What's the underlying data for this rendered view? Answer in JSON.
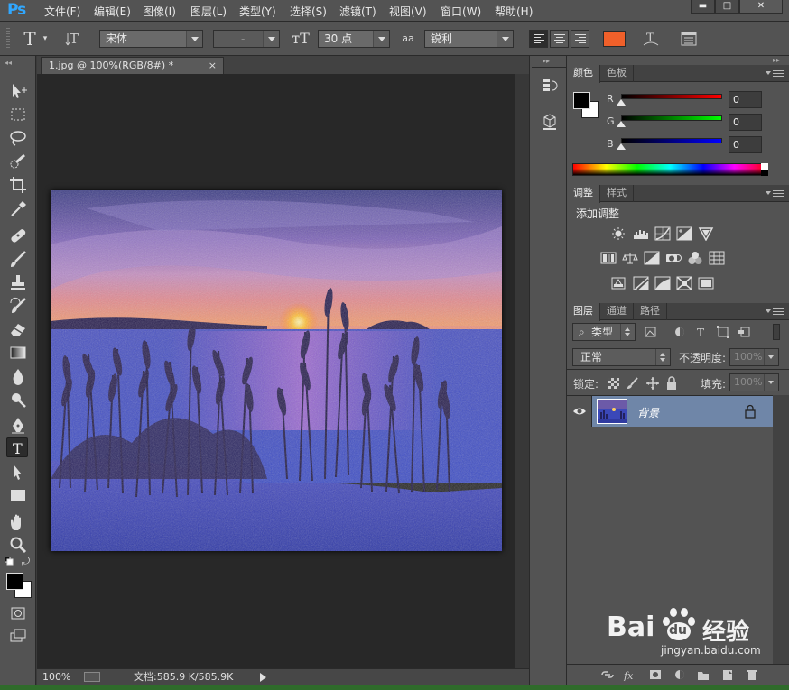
{
  "app": {
    "logo": "Ps"
  },
  "menu": [
    "文件(F)",
    "编辑(E)",
    "图像(I)",
    "图层(L)",
    "类型(Y)",
    "选择(S)",
    "滤镜(T)",
    "视图(V)",
    "窗口(W)",
    "帮助(H)"
  ],
  "window_controls": {
    "minimize": "▬",
    "maximize": "□",
    "close": "✕"
  },
  "options": {
    "font_family": "宋体",
    "font_style": "-",
    "font_size": "30 点",
    "antialias_label": "aa",
    "antialias": "锐利",
    "text_color": "#f0602a"
  },
  "document": {
    "tab_title": "1.jpg @ 100%(RGB/8#) *",
    "tab_close": "×",
    "zoom": "100%",
    "info": "文档:585.9 K/585.9K"
  },
  "tools": [
    "move-tool",
    "marquee-tool",
    "lasso-tool",
    "quick-selection-tool",
    "crop-tool",
    "eyedropper-tool",
    "healing-brush-tool",
    "brush-tool",
    "clone-stamp-tool",
    "history-brush-tool",
    "eraser-tool",
    "gradient-tool",
    "blur-tool",
    "dodge-tool",
    "pen-tool",
    "type-tool",
    "path-selection-tool",
    "rectangle-tool",
    "hand-tool",
    "zoom-tool"
  ],
  "color_panel": {
    "tabs": [
      "颜色",
      "色板"
    ],
    "foreground": "#000000",
    "background": "#ffffff",
    "channels": [
      {
        "label": "R",
        "value": "0"
      },
      {
        "label": "G",
        "value": "0"
      },
      {
        "label": "B",
        "value": "0"
      }
    ]
  },
  "adjustments_panel": {
    "tabs": [
      "调整",
      "样式"
    ],
    "title": "添加调整"
  },
  "layers_panel": {
    "tabs": [
      "图层",
      "通道",
      "路径"
    ],
    "filter": "类型",
    "blend_mode": "正常",
    "opacity_label": "不透明度:",
    "opacity": "100%",
    "lock_label": "锁定:",
    "fill_label": "填充:",
    "fill": "100%",
    "layers": [
      {
        "name": "背景",
        "visible": true,
        "locked": true
      }
    ]
  },
  "watermark": {
    "brand": "Bai",
    "paw": "du",
    "product": "经验",
    "url": "jingyan.baidu.com"
  }
}
